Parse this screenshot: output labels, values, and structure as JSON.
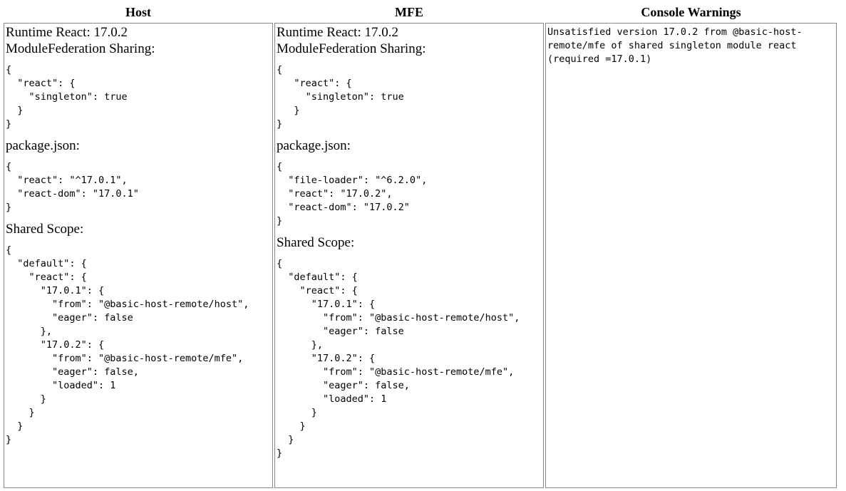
{
  "headers": {
    "host": "Host",
    "mfe": "MFE",
    "console": "Console Warnings"
  },
  "host": {
    "runtime": "Runtime React: 17.0.2",
    "sharing_label": "ModuleFederation Sharing:",
    "sharing_json": "{\n  \"react\": {\n    \"singleton\": true\n  }\n}",
    "package_label": "package.json:",
    "package_json": "{\n  \"react\": \"^17.0.1\",\n  \"react-dom\": \"17.0.1\"\n}",
    "scope_label": "Shared Scope:",
    "scope_json": "{\n  \"default\": {\n    \"react\": {\n      \"17.0.1\": {\n        \"from\": \"@basic-host-remote/host\",\n        \"eager\": false\n      },\n      \"17.0.2\": {\n        \"from\": \"@basic-host-remote/mfe\",\n        \"eager\": false,\n        \"loaded\": 1\n      }\n    }\n  }\n}"
  },
  "mfe": {
    "runtime": "Runtime React: 17.0.2",
    "sharing_label": "ModuleFederation Sharing:",
    "sharing_json": "{\n   \"react\": {\n     \"singleton\": true\n   }\n}",
    "package_label": "package.json:",
    "package_json": "{\n  \"file-loader\": \"^6.2.0\",\n  \"react\": \"17.0.2\",\n  \"react-dom\": \"17.0.2\"\n}",
    "scope_label": "Shared Scope:",
    "scope_json": "{\n  \"default\": {\n    \"react\": {\n      \"17.0.1\": {\n        \"from\": \"@basic-host-remote/host\",\n        \"eager\": false\n      },\n      \"17.0.2\": {\n        \"from\": \"@basic-host-remote/mfe\",\n        \"eager\": false,\n        \"loaded\": 1\n      }\n    }\n  }\n}"
  },
  "console": {
    "warning": "Unsatisfied version 17.0.2 from @basic-host-remote/mfe of shared singleton module react (required =17.0.1)"
  }
}
